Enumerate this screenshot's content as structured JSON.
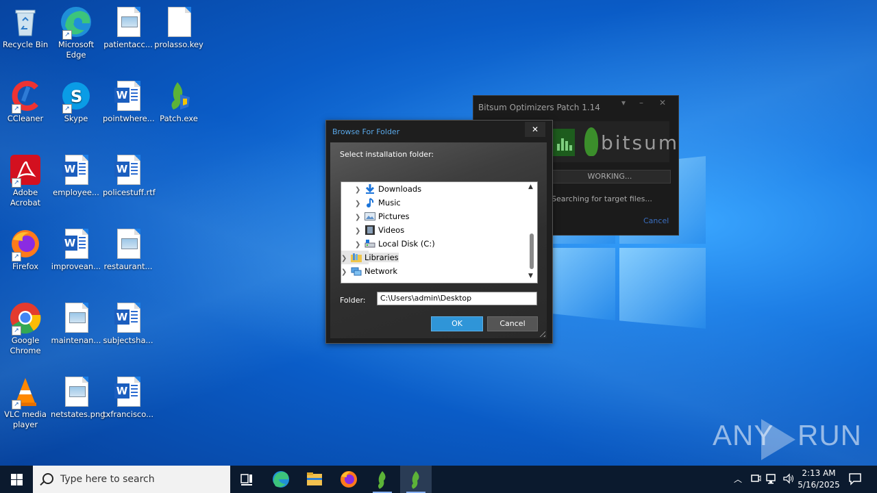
{
  "desktop_icons": [
    {
      "label": "Recycle Bin"
    },
    {
      "label": "Microsoft Edge"
    },
    {
      "label": "patientacc..."
    },
    {
      "label": "prolasso.key"
    },
    {
      "label": "CCleaner"
    },
    {
      "label": "Skype"
    },
    {
      "label": "pointwhere..."
    },
    {
      "label": "Patch.exe"
    },
    {
      "label": "Adobe Acrobat"
    },
    {
      "label": "employee..."
    },
    {
      "label": "policestuff.rtf"
    },
    {
      "label": "Firefox"
    },
    {
      "label": "improvean..."
    },
    {
      "label": "restaurant..."
    },
    {
      "label": "Google Chrome"
    },
    {
      "label": "maintenan..."
    },
    {
      "label": "subjectsha..."
    },
    {
      "label": "VLC media player"
    },
    {
      "label": "netstates.png"
    },
    {
      "label": "txfrancisco..."
    }
  ],
  "bitsum_window": {
    "title": "Bitsum Optimizers Patch 1.14",
    "brand": "bitsum",
    "status": "WORKING...",
    "message": "Searching for target files...",
    "cancel": "Cancel"
  },
  "browse_dialog": {
    "title": "Browse For Folder",
    "close": "✕",
    "prompt": "Select installation folder:",
    "tree": [
      {
        "label": "Downloads",
        "icon": "downloads-icon"
      },
      {
        "label": "Music",
        "icon": "music-icon"
      },
      {
        "label": "Pictures",
        "icon": "pictures-icon"
      },
      {
        "label": "Videos",
        "icon": "videos-icon"
      },
      {
        "label": "Local Disk (C:)",
        "icon": "disk-icon"
      },
      {
        "label": "Libraries",
        "icon": "libraries-icon"
      },
      {
        "label": "Network",
        "icon": "network-icon"
      }
    ],
    "folder_label": "Folder:",
    "folder_value": "C:\\Users\\admin\\Desktop",
    "ok": "OK",
    "cancel": "Cancel"
  },
  "watermark": {
    "left": "ANY",
    "right": "RUN"
  },
  "taskbar": {
    "search_placeholder": "Type here to search",
    "time": "2:13 AM",
    "date": "5/16/2025"
  },
  "colors": {
    "desktop_blue": "#0a5cc7",
    "taskbar": "#0b1a2e",
    "dialog_accent": "#2f95d8"
  }
}
